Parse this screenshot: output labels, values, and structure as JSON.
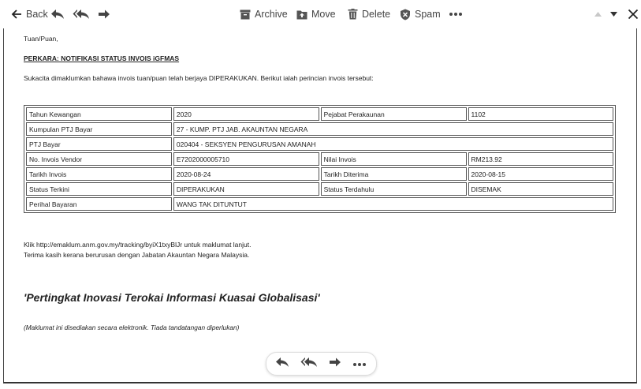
{
  "toolbar": {
    "back_label": "Back",
    "archive_label": "Archive",
    "move_label": "Move",
    "delete_label": "Delete",
    "spam_label": "Spam"
  },
  "email": {
    "greeting": "Tuan/Puan,",
    "subject": "PERKARA: NOTIFIKASI STATUS INVOIS iGFMAS",
    "intro": "Sukacita dimaklumkan bahawa invois tuan/puan telah berjaya DIPERAKUKAN. Berikut ialah perincian invois tersebut:",
    "table": {
      "tahun_label": "Tahun Kewangan",
      "tahun_value": "2020",
      "pejabat_label": "Pejabat Perakaunan",
      "pejabat_value": "1102",
      "kumpulan_label": "Kumpulan PTJ Bayar",
      "kumpulan_value": "27 - KUMP. PTJ JAB. AKAUNTAN NEGARA",
      "ptj_label": "PTJ Bayar",
      "ptj_value": "020404 - SEKSYEN PENGURUSAN AMANAH",
      "noinvois_label": "No. Invois Vendor",
      "noinvois_value": "E7202000005710",
      "nilai_label": "Nilai Invois",
      "nilai_value": "RM213.92",
      "tarikh_invois_label": "Tarikh Invois",
      "tarikh_invois_value": "2020-08-24",
      "tarikh_diterima_label": "Tarikh Diterima",
      "tarikh_diterima_value": "2020-08-15",
      "status_terkini_label": "Status Terkini",
      "status_terkini_value": "DIPERAKUKAN",
      "status_terdahulu_label": "Status Terdahulu",
      "status_terdahulu_value": "DISEMAK",
      "perihal_label": "Perihal Bayaran",
      "perihal_value": "WANG TAK DITUNTUT"
    },
    "link_line": "Klik http://emaklum.anm.gov.my/tracking/byiX1txyBlJr untuk maklumat lanjut.",
    "thanks_line": "Terima kasih kerana berurusan dengan Jabatan Akauntan Negara Malaysia.",
    "motto": "'Pertingkat Inovasi Terokai Informasi Kuasai Globalisasi'",
    "note": "(Maklumat ini disediakan secara elektronik. Tiada tandatangan diperlukan)"
  }
}
